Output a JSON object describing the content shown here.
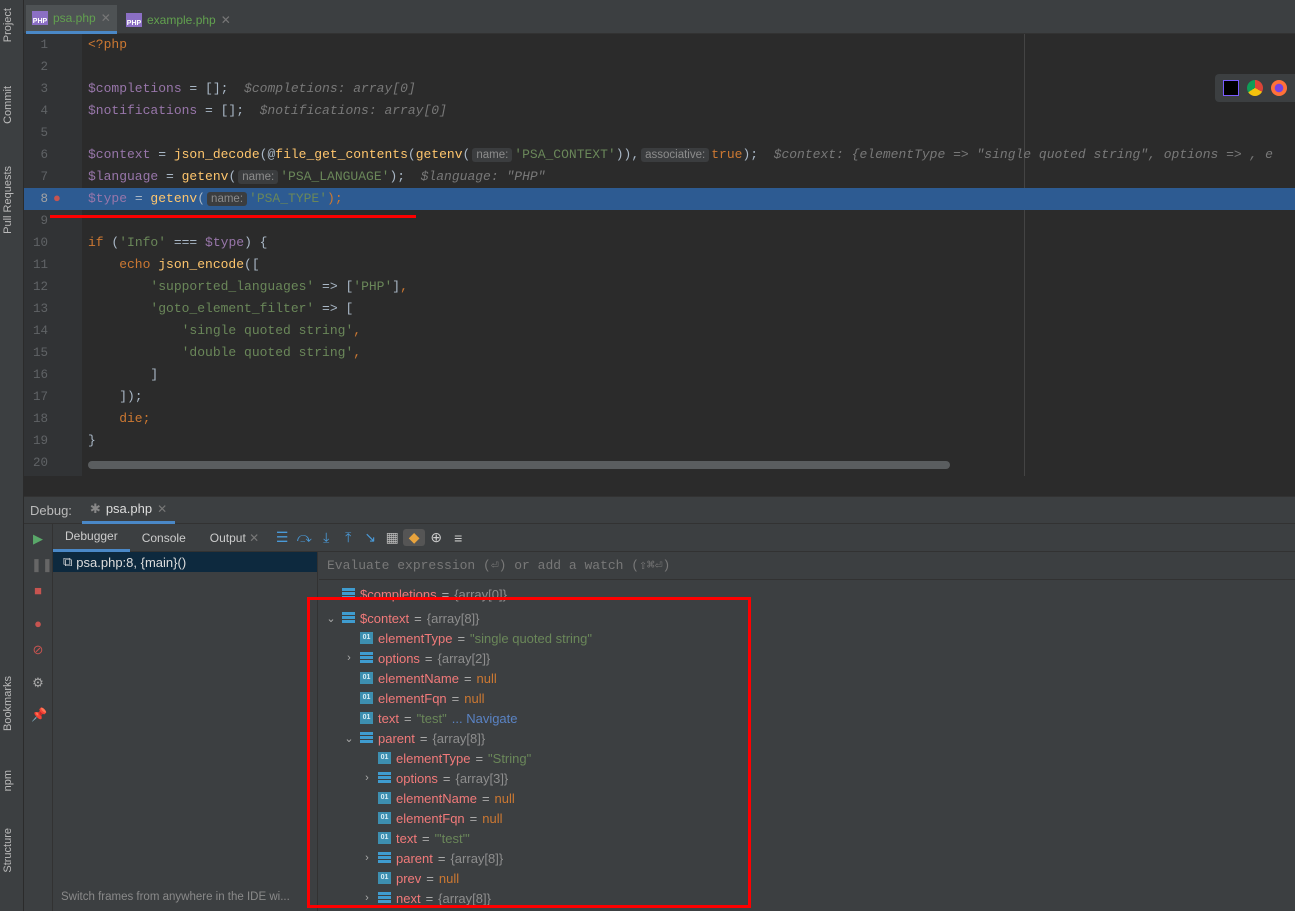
{
  "sidebar": {
    "top": [
      "Project",
      "Commit",
      "Pull Requests"
    ],
    "bottom": [
      "Bookmarks",
      "npm",
      "Structure"
    ]
  },
  "tabs": [
    {
      "label": "psa.php",
      "active": true
    },
    {
      "label": "example.php",
      "active": false
    }
  ],
  "file_icon_label": "PHP",
  "editor": {
    "current_line": 8,
    "lines": [
      [
        {
          "t": "<?php",
          "c": "kw"
        }
      ],
      [],
      [
        {
          "t": "$completions",
          "c": "var"
        },
        {
          "t": " = [];",
          "c": "pl"
        },
        {
          "t": "  $completions: array[0]",
          "c": "hint"
        }
      ],
      [
        {
          "t": "$notifications",
          "c": "var"
        },
        {
          "t": " = [];",
          "c": "pl"
        },
        {
          "t": "  $notifications: array[0]",
          "c": "hint"
        }
      ],
      [],
      [
        {
          "t": "$context",
          "c": "var"
        },
        {
          "t": " = ",
          "c": "pl"
        },
        {
          "t": "json_decode",
          "c": "fn"
        },
        {
          "t": "(@",
          "c": "pl"
        },
        {
          "t": "file_get_contents",
          "c": "fn"
        },
        {
          "t": "(",
          "c": "pl"
        },
        {
          "t": "getenv",
          "c": "fn"
        },
        {
          "t": "(",
          "c": "pl"
        },
        {
          "t": "name:",
          "c": "param"
        },
        {
          "t": "'PSA_CONTEXT'",
          "c": "str"
        },
        {
          "t": ")),",
          "c": "pl"
        },
        {
          "t": "associative:",
          "c": "param"
        },
        {
          "t": "true",
          "c": "kw"
        },
        {
          "t": ");",
          "c": "pl"
        },
        {
          "t": "  $context: {elementType => \"single quoted string\", options => , e",
          "c": "hint"
        }
      ],
      [
        {
          "t": "$language",
          "c": "var"
        },
        {
          "t": " = ",
          "c": "pl"
        },
        {
          "t": "getenv",
          "c": "fn"
        },
        {
          "t": "(",
          "c": "pl"
        },
        {
          "t": "name:",
          "c": "param"
        },
        {
          "t": "'PSA_LANGUAGE'",
          "c": "str"
        },
        {
          "t": ");",
          "c": "pl"
        },
        {
          "t": "  $language: \"PHP\"",
          "c": "hint"
        }
      ],
      [
        {
          "t": "$type",
          "c": "var"
        },
        {
          "t": " = ",
          "c": "pl"
        },
        {
          "t": "getenv",
          "c": "fn"
        },
        {
          "t": "(",
          "c": "pl"
        },
        {
          "t": "name:",
          "c": "param"
        },
        {
          "t": "'PSA_TYPE'",
          "c": "str"
        },
        {
          "t": ");",
          "c": "kw"
        }
      ],
      [],
      [
        {
          "t": "if",
          "c": "kw"
        },
        {
          "t": " (",
          "c": "pl"
        },
        {
          "t": "'Info'",
          "c": "str"
        },
        {
          "t": " === ",
          "c": "pl"
        },
        {
          "t": "$type",
          "c": "var"
        },
        {
          "t": ") {",
          "c": "pl"
        }
      ],
      [
        {
          "t": "    echo ",
          "c": "kw"
        },
        {
          "t": "json_encode",
          "c": "fn"
        },
        {
          "t": "([",
          "c": "pl"
        }
      ],
      [
        {
          "t": "        'supported_languages'",
          "c": "str"
        },
        {
          "t": " => [",
          "c": "pl"
        },
        {
          "t": "'PHP'",
          "c": "str"
        },
        {
          "t": "]",
          "c": "pl"
        },
        {
          "t": ",",
          "c": "kw"
        }
      ],
      [
        {
          "t": "        'goto_element_filter'",
          "c": "str"
        },
        {
          "t": " => [",
          "c": "pl"
        }
      ],
      [
        {
          "t": "            'single quoted string'",
          "c": "str"
        },
        {
          "t": ",",
          "c": "kw"
        }
      ],
      [
        {
          "t": "            'double quoted string'",
          "c": "str"
        },
        {
          "t": ",",
          "c": "kw"
        }
      ],
      [
        {
          "t": "        ]",
          "c": "pl"
        }
      ],
      [
        {
          "t": "    ]);",
          "c": "pl"
        }
      ],
      [
        {
          "t": "    die;",
          "c": "kw"
        }
      ],
      [
        {
          "t": "}",
          "c": "pl"
        }
      ],
      []
    ]
  },
  "browser_icons": [
    "phpstorm-icon",
    "chrome-icon",
    "firefox-icon"
  ],
  "debug": {
    "label": "Debug:",
    "session_tab": "psa.php",
    "tabs": [
      "Debugger",
      "Console",
      "Output"
    ],
    "frame": "psa.php:8, {main}()",
    "frames_hint": "Switch frames from anywhere in the IDE wi...",
    "eval_placeholder": "Evaluate expression (⏎) or add a watch (⇧⌘⏎)",
    "variables": [
      {
        "level": 0,
        "arrow": "",
        "icon": "array",
        "name": "$completions",
        "value": "{array[0]}",
        "vc": "varr"
      },
      {
        "level": 0,
        "arrow": "down",
        "icon": "array",
        "name": "$context",
        "value": "{array[8]}",
        "vc": "varr"
      },
      {
        "level": 1,
        "arrow": "",
        "icon": "field",
        "name": "elementType",
        "value": "\"single quoted string\"",
        "vc": "vs"
      },
      {
        "level": 1,
        "arrow": "right",
        "icon": "array",
        "name": "options",
        "value": "{array[2]}",
        "vc": "varr"
      },
      {
        "level": 1,
        "arrow": "",
        "icon": "field",
        "name": "elementName",
        "value": "null",
        "vc": "vnull"
      },
      {
        "level": 1,
        "arrow": "",
        "icon": "field",
        "name": "elementFqn",
        "value": "null",
        "vc": "vnull"
      },
      {
        "level": 1,
        "arrow": "",
        "icon": "field",
        "name": "text",
        "value": "\"test\"",
        "vc": "vs",
        "link": "... Navigate"
      },
      {
        "level": 1,
        "arrow": "down",
        "icon": "array",
        "name": "parent",
        "value": "{array[8]}",
        "vc": "varr"
      },
      {
        "level": 2,
        "arrow": "",
        "icon": "field",
        "name": "elementType",
        "value": "\"String\"",
        "vc": "vs"
      },
      {
        "level": 2,
        "arrow": "right",
        "icon": "array",
        "name": "options",
        "value": "{array[3]}",
        "vc": "varr"
      },
      {
        "level": 2,
        "arrow": "",
        "icon": "field",
        "name": "elementName",
        "value": "null",
        "vc": "vnull"
      },
      {
        "level": 2,
        "arrow": "",
        "icon": "field",
        "name": "elementFqn",
        "value": "null",
        "vc": "vnull"
      },
      {
        "level": 2,
        "arrow": "",
        "icon": "field",
        "name": "text",
        "value": "\"'test'\"",
        "vc": "vs"
      },
      {
        "level": 2,
        "arrow": "right",
        "icon": "array",
        "name": "parent",
        "value": "{array[8]}",
        "vc": "varr"
      },
      {
        "level": 2,
        "arrow": "",
        "icon": "field",
        "name": "prev",
        "value": "null",
        "vc": "vnull"
      },
      {
        "level": 2,
        "arrow": "right",
        "icon": "array",
        "name": "next",
        "value": "{array[8]}",
        "vc": "varr"
      }
    ]
  },
  "colors": {
    "highlight": "#2d5b92",
    "annotation": "#ff0000",
    "accent": "#4a88c7"
  }
}
